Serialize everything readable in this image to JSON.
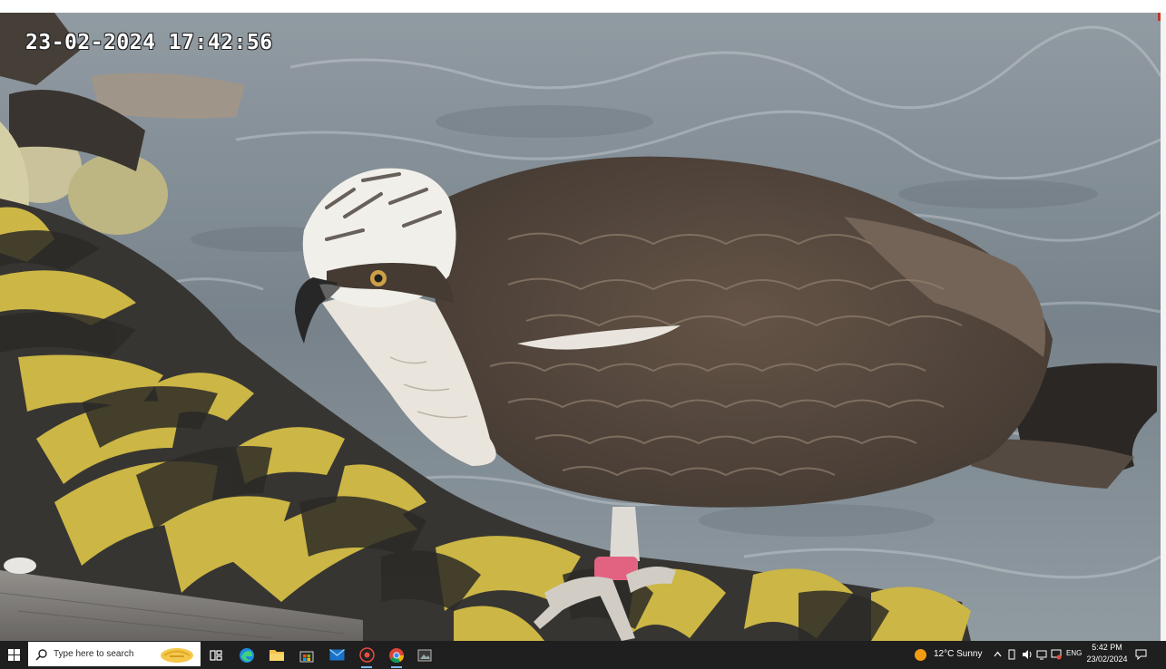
{
  "video": {
    "osd_timestamp": "23-02-2024  17:42:56",
    "subject": "osprey-on-rope"
  },
  "taskbar": {
    "search_placeholder": "Type here to search",
    "apps": [
      {
        "name": "task-view-icon"
      },
      {
        "name": "edge-icon"
      },
      {
        "name": "file-explorer-icon"
      },
      {
        "name": "microsoft-store-icon"
      },
      {
        "name": "mail-icon"
      },
      {
        "name": "screen-recorder-icon"
      },
      {
        "name": "chrome-icon"
      },
      {
        "name": "photos-app-icon"
      }
    ],
    "tray": {
      "weather": "12°C  Sunny",
      "language": "ENG",
      "time": "5:42 PM",
      "date": "23/02/2024"
    }
  },
  "colors": {
    "taskbar_bg": "#1f1f1f",
    "accent": "#76b9ed",
    "sea": "#7a858e",
    "rope_yellow": "#c9b23a",
    "rope_dark": "#2a2a2a",
    "leg_band": "#e05a7a"
  }
}
